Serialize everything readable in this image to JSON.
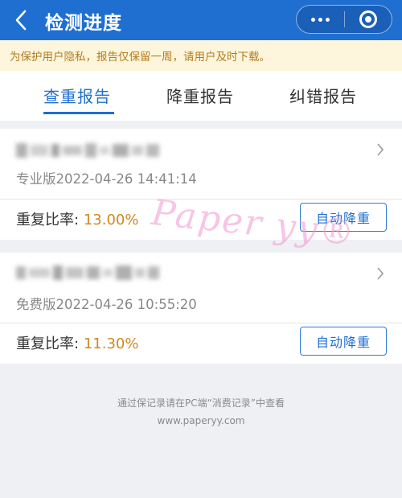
{
  "header": {
    "back_icon": "chevron-left-icon",
    "title": "检测进度",
    "more_icon": "more-dots-icon",
    "close_icon": "target-circle-icon",
    "bg_color": "#1f6fd1"
  },
  "notice": {
    "text": "为保护用户隐私，报告仅保留一周，请用户及时下载。"
  },
  "tabs": [
    {
      "label": "查重报告",
      "active": true
    },
    {
      "label": "降重报告",
      "active": false
    },
    {
      "label": "纠错报告",
      "active": false
    }
  ],
  "reports": [
    {
      "meta": "专业版2022-04-26 14:41:14",
      "rate_label": "重复比率:",
      "rate_value": "13.00%",
      "action_label": "自动降重"
    },
    {
      "meta": "免费版2022-04-26 10:55:20",
      "rate_label": "重复比率:",
      "rate_value": "11.30%",
      "action_label": "自动降重"
    }
  ],
  "footer": {
    "line1": "通过保记录请在PC端“消费记录”中查看",
    "line2": "www.paperyy.com"
  },
  "watermark": {
    "text": "Paper yy®"
  },
  "colors": {
    "accent": "#1f6fd1",
    "rate": "#d3861d",
    "notice_text": "#b37a1f",
    "notice_bg": "#fdf6dc"
  }
}
